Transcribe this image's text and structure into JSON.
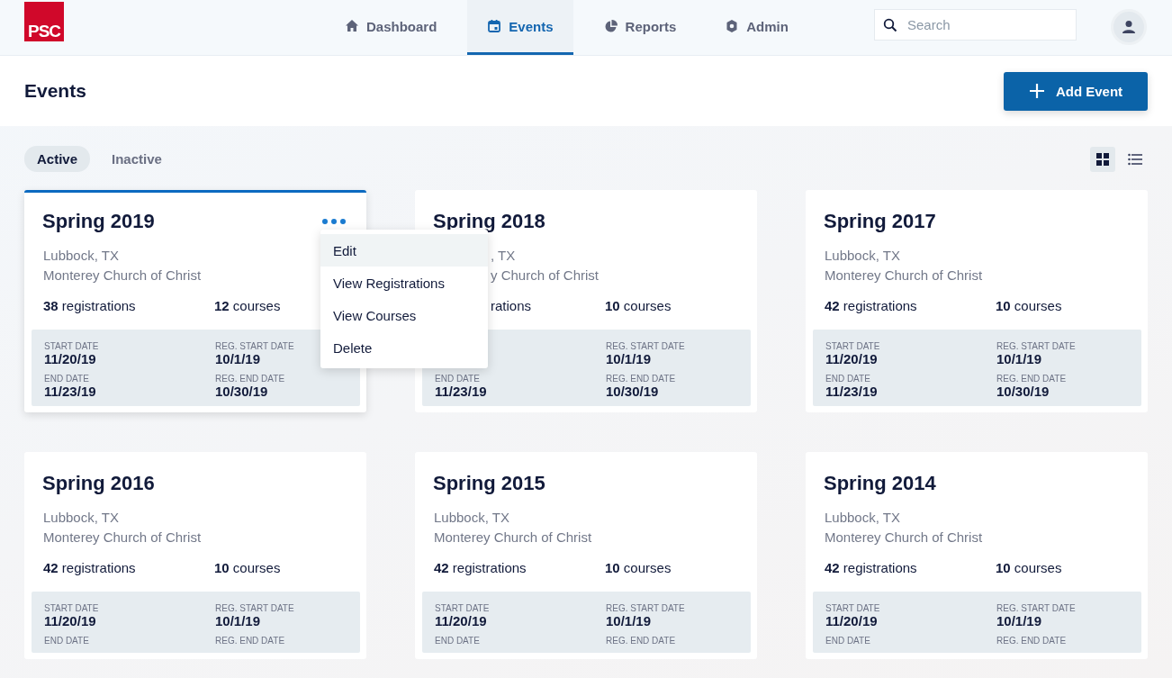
{
  "logo": {
    "text": "PSC"
  },
  "nav": [
    {
      "label": "Dashboard",
      "selected": false
    },
    {
      "label": "Events",
      "selected": true
    },
    {
      "label": "Reports",
      "selected": false
    },
    {
      "label": "Admin",
      "selected": false
    }
  ],
  "search": {
    "placeholder": "Search"
  },
  "page_title": "Events",
  "add_button": "Add Event",
  "filters": [
    {
      "label": "Active",
      "selected": true
    },
    {
      "label": "Inactive",
      "selected": false
    }
  ],
  "views": [
    {
      "kind": "grid",
      "selected": true
    },
    {
      "kind": "list",
      "selected": false
    }
  ],
  "events": [
    {
      "title": "Spring 2019",
      "location": "Lubbock, TX",
      "venue": "Monterey Church of Christ",
      "registrations": "38",
      "registrations_label": "registrations",
      "courses": "12",
      "courses_label": "courses",
      "selected": true,
      "under_menu": false,
      "start_date": {
        "label": "START DATE",
        "value": "11/20/19"
      },
      "reg_start_date": {
        "label": "REG. START DATE",
        "value": "10/1/19"
      },
      "end_date": {
        "label": "END DATE",
        "value": "11/23/19"
      },
      "reg_end_date": {
        "label": "REG. END DATE",
        "value": "10/30/19"
      }
    },
    {
      "title": "Spring 2018",
      "location": ", TX",
      "venue": "y Church of Christ",
      "registrations_label": "rations",
      "courses": "10",
      "courses_label": "courses",
      "selected": false,
      "under_menu": true,
      "reg_start_date": {
        "label": "REG. START DATE",
        "value": "10/1/19"
      },
      "end_date": {
        "label": "END DATE",
        "value": "11/23/19"
      },
      "reg_end_date": {
        "label": "REG. END DATE",
        "value": "10/30/19"
      }
    },
    {
      "title": "Spring 2017",
      "location": "Lubbock, TX",
      "venue": "Monterey Church of Christ",
      "registrations": "42",
      "registrations_label": "registrations",
      "courses": "10",
      "courses_label": "courses",
      "selected": false,
      "under_menu": false,
      "start_date": {
        "label": "START DATE",
        "value": "11/20/19"
      },
      "reg_start_date": {
        "label": "REG. START DATE",
        "value": "10/1/19"
      },
      "end_date": {
        "label": "END DATE",
        "value": "11/23/19"
      },
      "reg_end_date": {
        "label": "REG. END DATE",
        "value": "10/30/19"
      }
    },
    {
      "title": "Spring 2016",
      "location": "Lubbock, TX",
      "venue": "Monterey Church of Christ",
      "registrations": "42",
      "registrations_label": "registrations",
      "courses": "10",
      "courses_label": "courses",
      "selected": false,
      "under_menu": false,
      "start_date": {
        "label": "START DATE",
        "value": "11/20/19"
      },
      "reg_start_date": {
        "label": "REG. START DATE",
        "value": "10/1/19"
      },
      "end_date": {
        "label": "END DATE"
      },
      "reg_end_date": {
        "label": "REG. END DATE"
      }
    },
    {
      "title": "Spring 2015",
      "location": "Lubbock, TX",
      "venue": "Monterey Church of Christ",
      "registrations": "42",
      "registrations_label": "registrations",
      "courses": "10",
      "courses_label": "courses",
      "selected": false,
      "under_menu": false,
      "start_date": {
        "label": "START DATE",
        "value": "11/20/19"
      },
      "reg_start_date": {
        "label": "REG. START DATE",
        "value": "10/1/19"
      },
      "end_date": {
        "label": "END DATE"
      },
      "reg_end_date": {
        "label": "REG. END DATE"
      }
    },
    {
      "title": "Spring 2014",
      "location": "Lubbock, TX",
      "venue": "Monterey Church of Christ",
      "registrations": "42",
      "registrations_label": "registrations",
      "courses": "10",
      "courses_label": "courses",
      "selected": false,
      "under_menu": false,
      "start_date": {
        "label": "START DATE",
        "value": "11/20/19"
      },
      "reg_start_date": {
        "label": "REG. START DATE",
        "value": "10/1/19"
      },
      "end_date": {
        "label": "END DATE"
      },
      "reg_end_date": {
        "label": "REG. END DATE"
      }
    }
  ],
  "context_menu": [
    {
      "label": "Edit",
      "selected": true
    },
    {
      "label": "View Registrations",
      "selected": false
    },
    {
      "label": "View Courses",
      "selected": false
    },
    {
      "label": "Delete",
      "selected": false
    }
  ]
}
